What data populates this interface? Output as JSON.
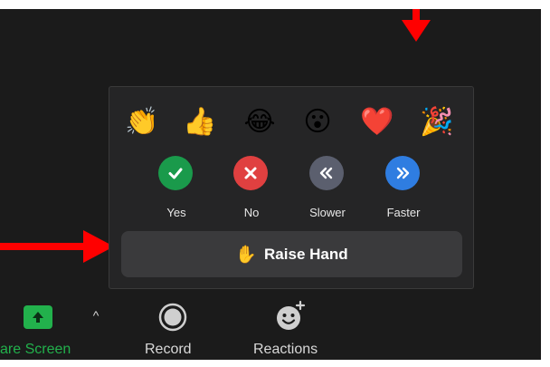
{
  "reactions": {
    "emojis": [
      {
        "name": "clap",
        "glyph": "👏"
      },
      {
        "name": "thumbs-up",
        "glyph": "👍"
      },
      {
        "name": "tears-of-joy",
        "glyph": "😂"
      },
      {
        "name": "open-mouth",
        "glyph": "😮"
      },
      {
        "name": "heart",
        "glyph": "❤️"
      },
      {
        "name": "party-popper",
        "glyph": "🎉"
      }
    ],
    "feedback": [
      {
        "label": "Yes",
        "color": "#1a9a4b",
        "icon": "check-icon"
      },
      {
        "label": "No",
        "color": "#e04040",
        "icon": "x-icon"
      },
      {
        "label": "Slower",
        "color": "#5b5f6e",
        "icon": "rewind-icon"
      },
      {
        "label": "Faster",
        "color": "#2f7de1",
        "icon": "fast-forward-icon"
      }
    ],
    "raise_hand": {
      "glyph": "✋",
      "label": "Raise Hand"
    }
  },
  "toolbar": {
    "share_label": "are Screen",
    "caret": "^",
    "record_label": "Record",
    "reactions_label": "Reactions"
  },
  "colors": {
    "annotation_arrow": "#ff0000",
    "share_green": "#22b14c",
    "popup_bg": "#252526",
    "button_bg": "#3a3a3c"
  }
}
